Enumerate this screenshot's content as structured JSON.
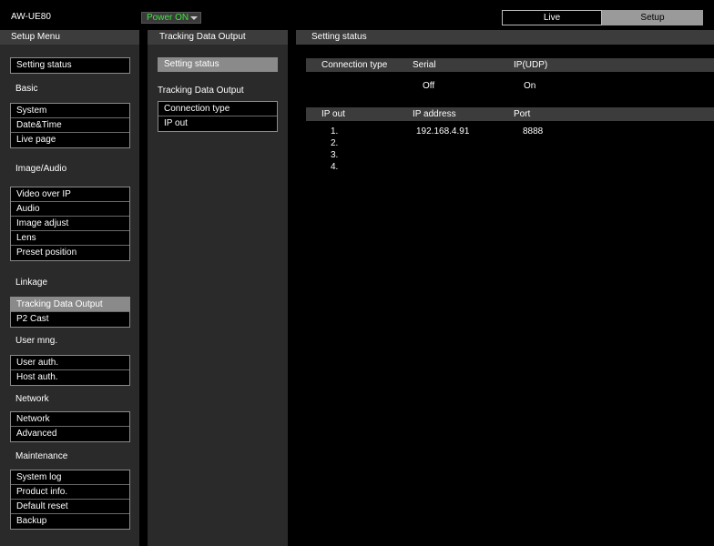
{
  "header": {
    "model": "AW-UE80",
    "power_label": "Power ON",
    "live_label": "Live",
    "setup_label": "Setup",
    "power_color": "#3ce83c"
  },
  "setup_menu": {
    "title": "Setup Menu",
    "setting_status": "Setting status",
    "sections": [
      {
        "label": "Basic",
        "items": [
          "System",
          "Date&Time",
          "Live page"
        ]
      },
      {
        "label": "Image/Audio",
        "items": [
          "Video over IP",
          "Audio",
          "Image adjust",
          "Lens",
          "Preset position"
        ]
      },
      {
        "label": "Linkage",
        "items": [
          "Tracking Data Output",
          "P2 Cast"
        ],
        "active": 0
      },
      {
        "label": "User mng.",
        "items": [
          "User auth.",
          "Host auth."
        ]
      },
      {
        "label": "Network",
        "items": [
          "Network",
          "Advanced"
        ]
      },
      {
        "label": "Maintenance",
        "items": [
          "System log",
          "Product info.",
          "Default reset",
          "Backup"
        ]
      }
    ]
  },
  "submenu": {
    "title": "Tracking Data Output",
    "setting_status": "Setting status",
    "group_title": "Tracking Data Output",
    "items": [
      "Connection type",
      "IP out"
    ]
  },
  "main": {
    "title": "Setting status",
    "connection": {
      "headers": [
        "Connection type",
        "Serial",
        "IP(UDP)"
      ],
      "values": [
        "Off",
        "On"
      ]
    },
    "ip_out": {
      "headers": [
        "IP out",
        "IP address",
        "Port"
      ],
      "rows": [
        {
          "num": "1.",
          "ip": "192.168.4.91",
          "port": "8888"
        },
        {
          "num": "2.",
          "ip": "",
          "port": ""
        },
        {
          "num": "3.",
          "ip": "",
          "port": ""
        },
        {
          "num": "4.",
          "ip": "",
          "port": ""
        }
      ]
    }
  }
}
